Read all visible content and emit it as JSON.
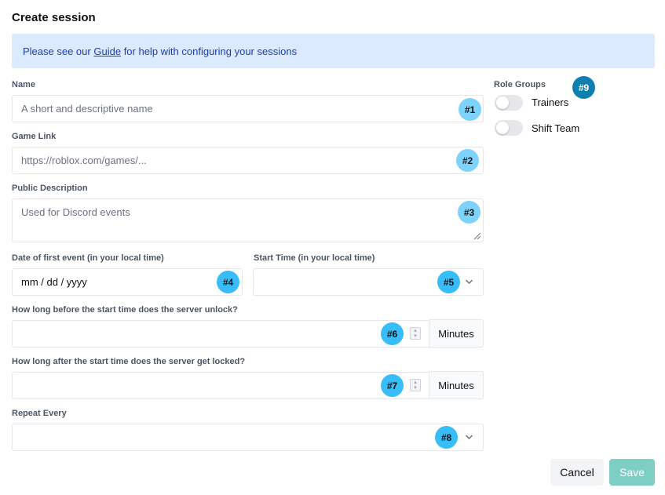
{
  "title": "Create session",
  "banner": {
    "before": "Please see our ",
    "link": "Guide",
    "after": " for help with configuring your sessions"
  },
  "fields": {
    "name": {
      "label": "Name",
      "placeholder": "A short and descriptive name",
      "badge": "#1"
    },
    "game_link": {
      "label": "Game Link",
      "placeholder": "https://roblox.com/games/...",
      "badge": "#2"
    },
    "description": {
      "label": "Public Description",
      "placeholder": "Used for Discord events",
      "badge": "#3"
    },
    "date": {
      "label": "Date of first event (in your local time)",
      "placeholder": "mm / dd / yyyy",
      "badge": "#4"
    },
    "start_time": {
      "label": "Start Time (in your local time)",
      "value": "",
      "badge": "#5"
    },
    "unlock": {
      "label": "How long before the start time does the server unlock?",
      "value": "",
      "unit": "Minutes",
      "badge": "#6"
    },
    "lock": {
      "label": "How long after the start time does the server get locked?",
      "value": "",
      "unit": "Minutes",
      "badge": "#7"
    },
    "repeat": {
      "label": "Repeat Every",
      "value": "",
      "badge": "#8"
    }
  },
  "role_groups": {
    "label": "Role Groups",
    "badge": "#9",
    "items": [
      {
        "label": "Trainers",
        "enabled": false
      },
      {
        "label": "Shift Team",
        "enabled": false
      }
    ]
  },
  "actions": {
    "cancel": "Cancel",
    "save": "Save"
  },
  "colors": {
    "banner_bg": "#dbeafe",
    "badge": "#7dd3fc",
    "badge_dark": "#0e7fae",
    "save": "#7ccfc2"
  },
  "icons": {
    "dropdown": "chevron-down-icon",
    "spinner": "spinner-arrows-icon",
    "resize": "resize-grip-icon"
  }
}
